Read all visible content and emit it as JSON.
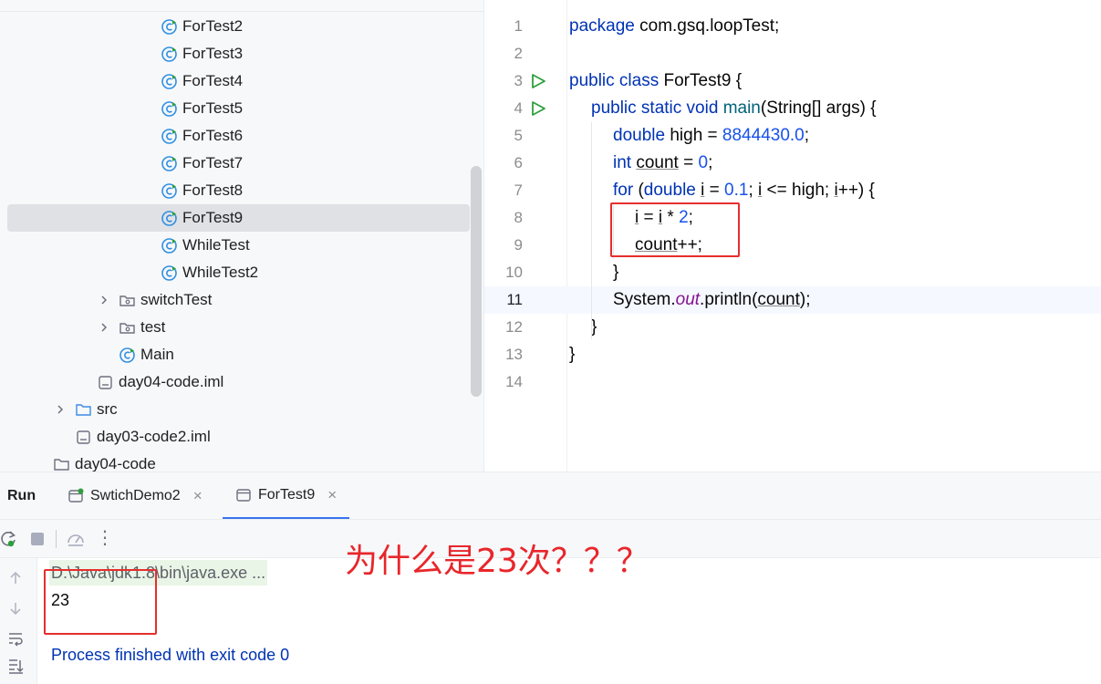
{
  "project_tree": {
    "items": [
      {
        "label": "ForTest2",
        "kind": "class",
        "depth": 3
      },
      {
        "label": "ForTest3",
        "kind": "class",
        "depth": 3
      },
      {
        "label": "ForTest4",
        "kind": "class",
        "depth": 3
      },
      {
        "label": "ForTest5",
        "kind": "class",
        "depth": 3
      },
      {
        "label": "ForTest6",
        "kind": "class",
        "depth": 3
      },
      {
        "label": "ForTest7",
        "kind": "class",
        "depth": 3
      },
      {
        "label": "ForTest8",
        "kind": "class",
        "depth": 3
      },
      {
        "label": "ForTest9",
        "kind": "class",
        "depth": 3,
        "selected": true
      },
      {
        "label": "WhileTest",
        "kind": "class",
        "depth": 3
      },
      {
        "label": "WhileTest2",
        "kind": "class",
        "depth": 3
      },
      {
        "label": "switchTest",
        "kind": "package",
        "depth": 2,
        "collapsed": true
      },
      {
        "label": "test",
        "kind": "package",
        "depth": 2,
        "collapsed": true
      },
      {
        "label": "Main",
        "kind": "class",
        "depth": 2
      },
      {
        "label": "day04-code.iml",
        "kind": "file",
        "depth": 1
      },
      {
        "label": "src",
        "kind": "folder",
        "depth": 0,
        "collapsed": true
      },
      {
        "label": "day03-code2.iml",
        "kind": "file",
        "depth": 0
      },
      {
        "label": "day04-code",
        "kind": "folder",
        "depth": -1
      }
    ]
  },
  "editor": {
    "line_numbers": [
      "1",
      "2",
      "3",
      "4",
      "5",
      "6",
      "7",
      "8",
      "9",
      "10",
      "11",
      "12",
      "13",
      "14"
    ],
    "current_line": "11",
    "run_gutter_lines": [
      "3",
      "4"
    ],
    "code": {
      "l1": {
        "kw": "package",
        "rest": " com.gsq.loopTest;"
      },
      "l3": {
        "kw": "public class",
        "rest": " ForTest9 {"
      },
      "l4": {
        "kw": "public static void",
        "fn": "main",
        "rest": "(String[] args) {"
      },
      "l5": {
        "kw": "double",
        "mid": " high = ",
        "num": "8844430.0",
        "end": ";"
      },
      "l6": {
        "kw": "int",
        "sp": " ",
        "var": "count",
        "mid": " = ",
        "num": "0",
        "end": ";"
      },
      "l7": {
        "kw1": "for",
        "p1": " (",
        "kw2": "double",
        "sp": " ",
        "var1": "i",
        "mid1": " = ",
        "num": "0.1",
        "mid2": "; ",
        "var2": "i",
        "mid3": " <= high; ",
        "var3": "i",
        "end": "++) {"
      },
      "l8": {
        "var1": "i",
        "mid": " = ",
        "var2": "i",
        "op": " * ",
        "num": "2",
        "end": ";"
      },
      "l9": {
        "var": "count",
        "end": "++;"
      },
      "l10": "}",
      "l11": {
        "cls": "System.",
        "fld": "out",
        "call": ".println(",
        "var": "count",
        "end": ");"
      },
      "l12": "}",
      "l13": "}"
    }
  },
  "run_panel": {
    "title": "Run",
    "tabs": [
      {
        "label": "SwtichDemo2",
        "active": false
      },
      {
        "label": "ForTest9",
        "active": true
      }
    ],
    "close_glyph": "×",
    "more_glyph": "⋮",
    "console": {
      "command": "D:\\Java\\jdk1.8\\bin\\java.exe ...",
      "output": "23",
      "exit_message": "Process finished with exit code 0"
    }
  },
  "annotation": {
    "text": "为什么是23次？？？",
    "color": "#e8262b"
  },
  "colors": {
    "keyword": "#0033b3",
    "number": "#1750eb",
    "method": "#00627a",
    "field": "#871094",
    "run_green": "#2e9e3e",
    "class_icon": "#2f8fe0",
    "highlight_box": "#e62e2e",
    "active_tab": "#3574f0"
  }
}
